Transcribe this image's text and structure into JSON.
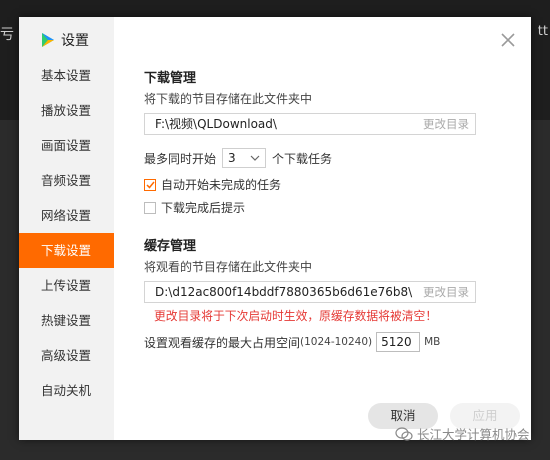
{
  "background": {
    "left_text": "亏 蓝",
    "right_text": "tt"
  },
  "window": {
    "title": "设置"
  },
  "sidebar": {
    "items": [
      {
        "label": "基本设置"
      },
      {
        "label": "播放设置"
      },
      {
        "label": "画面设置"
      },
      {
        "label": "音频设置"
      },
      {
        "label": "网络设置"
      },
      {
        "label": "下载设置",
        "active": true
      },
      {
        "label": "上传设置"
      },
      {
        "label": "热键设置"
      },
      {
        "label": "高级设置"
      },
      {
        "label": "自动关机"
      }
    ]
  },
  "download": {
    "title": "下载管理",
    "desc": "将下载的节目存储在此文件夹中",
    "path": "F:\\视频\\QLDownload\\",
    "change_label": "更改目录",
    "concurrent_prefix": "最多同时开始",
    "concurrent_value": "3",
    "concurrent_suffix": "个下载任务",
    "auto_start_label": "自动开始未完成的任务",
    "auto_start_checked": true,
    "notify_label": "下载完成后提示",
    "notify_checked": false
  },
  "cache": {
    "title": "缓存管理",
    "desc": "将观看的节目存储在此文件夹中",
    "path": "D:\\d12ac800f14bddf7880365b6d61e76b8\\",
    "change_label": "更改目录",
    "warning": "更改目录将于下次启动时生效，原缓存数据将被清空！",
    "size_prefix": "设置观看缓存的最大占用空间",
    "size_range": "(1024-10240)",
    "size_value": "5120",
    "size_unit": "MB"
  },
  "buttons": {
    "cancel": "取消",
    "apply": "应用"
  },
  "watermark": {
    "text": "长江大学计算机协会"
  },
  "colors": {
    "accent": "#ff6a00",
    "warning": "#e53935"
  }
}
